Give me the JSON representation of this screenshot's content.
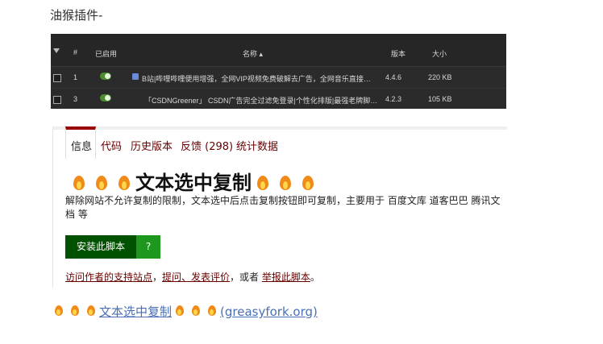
{
  "blog": {
    "title": "油猴插件-"
  },
  "tm_table": {
    "headers": {
      "index": "#",
      "enabled": "已启用",
      "name": "名称 ▴",
      "version": "版本",
      "size": "大小"
    },
    "rows": [
      {
        "index": "1",
        "name": "B站|哔哩哔哩便用增强，全网VIP视频免费破解去广告，全网音乐直接下载...",
        "version": "4.4.6",
        "size": "220 KB"
      },
      {
        "index": "3",
        "name": "「CSDNGreener」 CSDN广告完全过滤免登录|个性化排版|最强老牌脚本...",
        "version": "4.2.3",
        "size": "105 KB"
      }
    ]
  },
  "greasyfork": {
    "tabs": [
      "信息",
      "代码",
      "历史版本",
      "反馈 (298)",
      "统计数据"
    ],
    "title": "文本选中复制",
    "description": "解除网站不允许复制的限制，文本选中后点击复制按钮即可复制，主要用于 百度文库 道客巴巴 腾讯文档 等",
    "install_label": "安装此脚本",
    "help_label": "?",
    "links": {
      "support": "访问作者的支持站点",
      "sep1": "，",
      "feedback": "提问、发表评价",
      "or": "，或者 ",
      "report": "举报此脚本",
      "end": "。"
    }
  },
  "bottom_link": {
    "text": "文本选中复制",
    "domain": "(greasyfork.org)"
  },
  "colors": {
    "install": "#005200",
    "help": "#1e971e",
    "link": "#670000",
    "bottom_link": "#4a6fb5",
    "tab_accent": "#990000"
  }
}
